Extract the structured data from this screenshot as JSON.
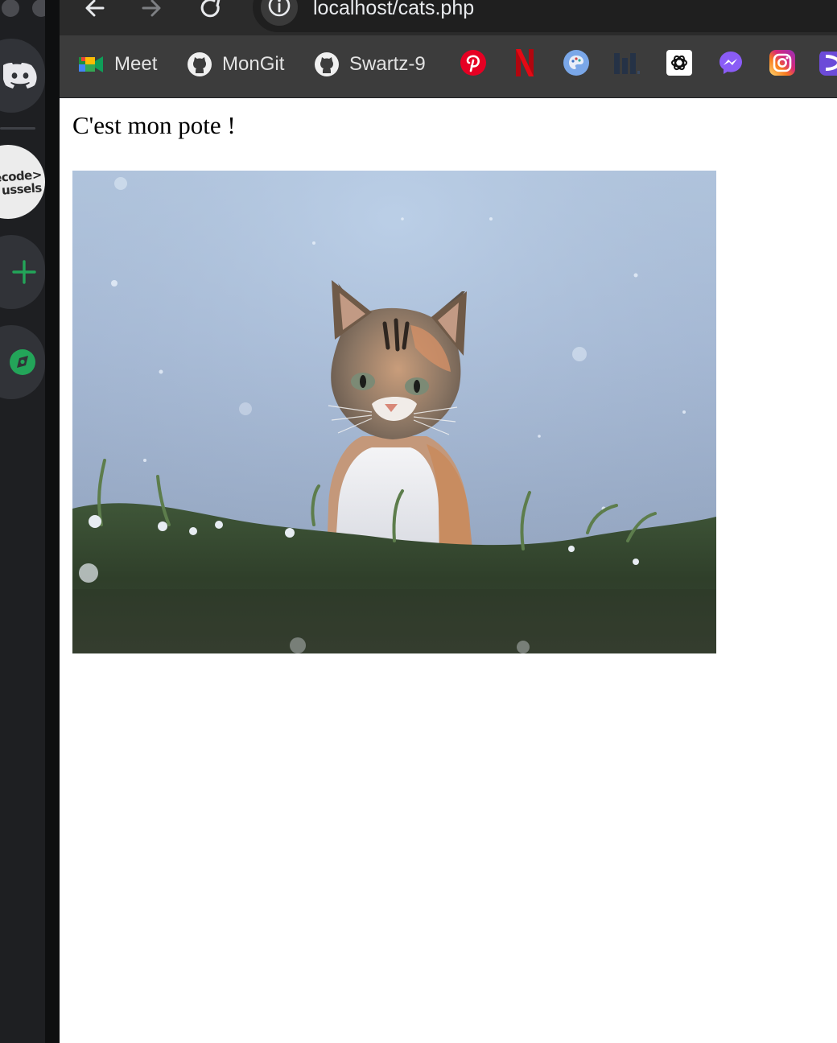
{
  "browser": {
    "url": "localhost/cats.php",
    "bookmarks": [
      {
        "label": "Meet",
        "icon": "google-meet-icon"
      },
      {
        "label": "MonGit",
        "icon": "github-icon"
      },
      {
        "label": "Swartz-9",
        "icon": "github-icon"
      }
    ],
    "icon_bookmarks": [
      "pinterest-icon",
      "netflix-icon",
      "palette-icon",
      "bar-chart-icon",
      "openai-icon",
      "messenger-icon",
      "instagram-icon",
      "app-icon"
    ]
  },
  "discord": {
    "servers": [
      {
        "icon": "discord-icon"
      },
      {
        "icon": "becode-server-icon",
        "label_lines": [
          "ecode>",
          "ussels"
        ]
      },
      {
        "icon": "add-server-icon"
      },
      {
        "icon": "explore-servers-icon"
      }
    ]
  },
  "page": {
    "heading": "C'est mon pote !",
    "image": {
      "subject": "cat in grass",
      "icon": "cat-photo"
    }
  },
  "colors": {
    "chrome_bg": "#3c3c3c",
    "discord_bg": "#1e1f22",
    "discord_green": "#23a559",
    "page_bg": "#ffffff"
  }
}
